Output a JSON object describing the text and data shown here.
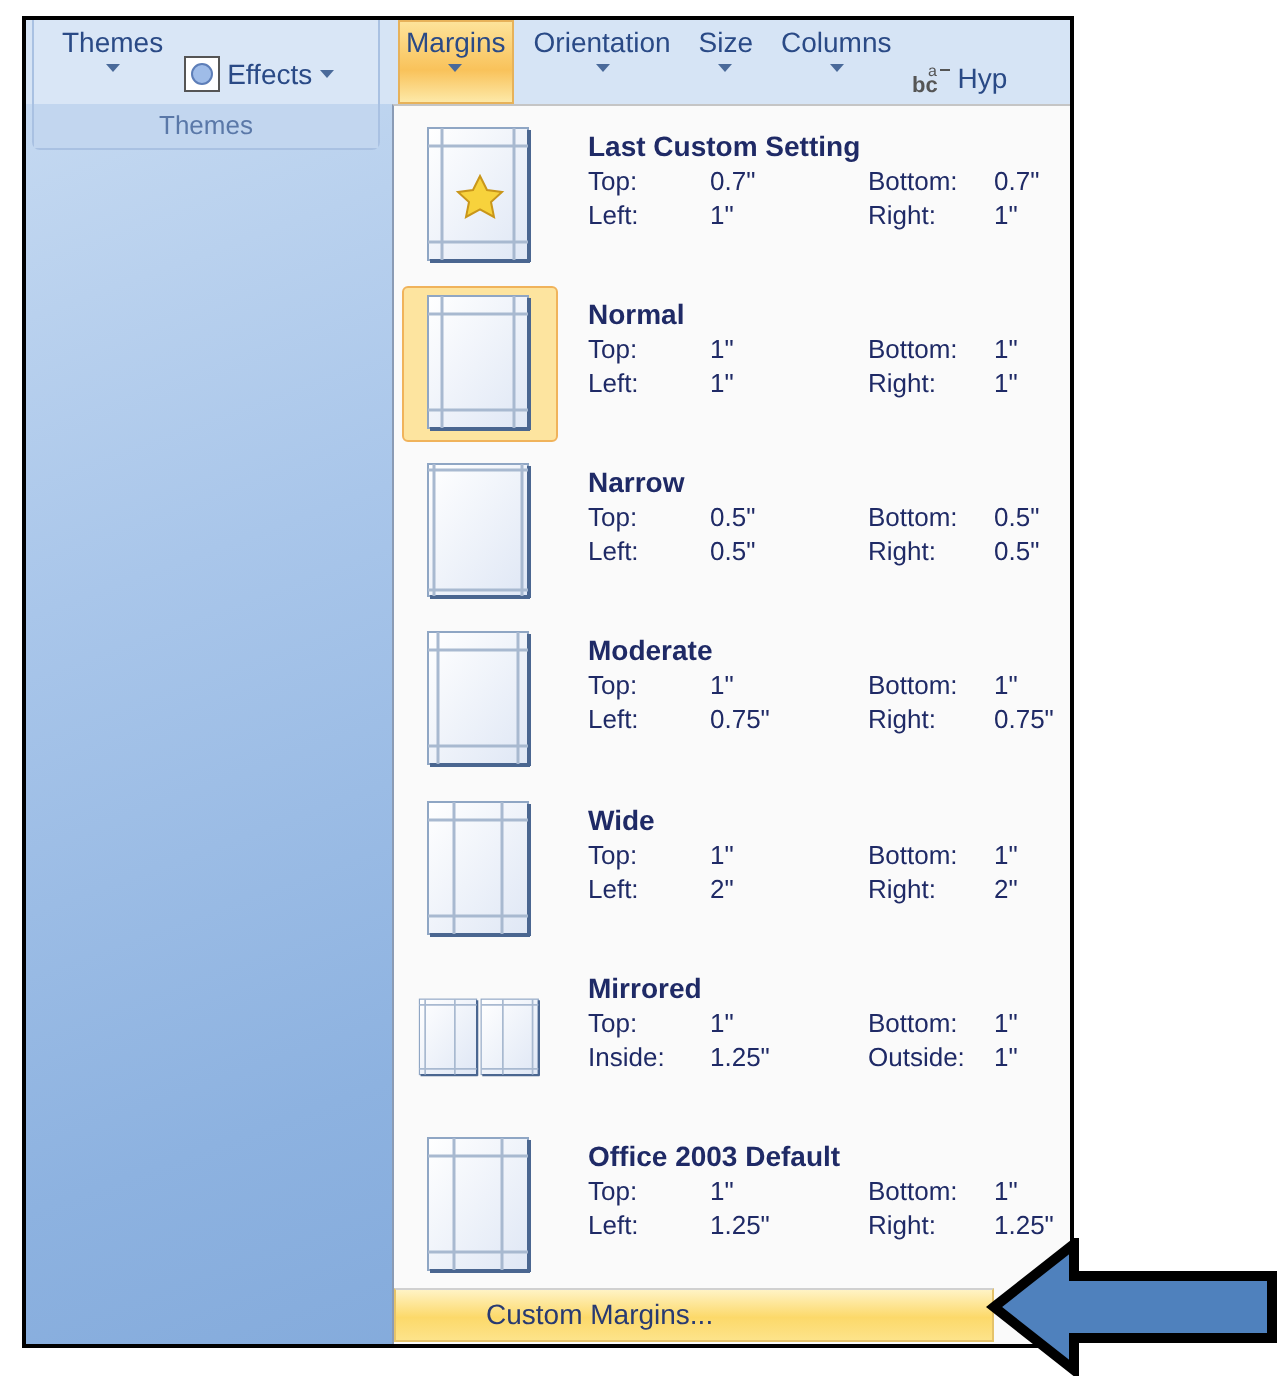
{
  "ribbon": {
    "themes_group": {
      "themes_button": "Themes",
      "effects_button": "Effects",
      "group_label": "Themes"
    },
    "buttons": [
      {
        "label": "Margins",
        "selected": true
      },
      {
        "label": "Orientation",
        "selected": false
      },
      {
        "label": "Size",
        "selected": false
      },
      {
        "label": "Columns",
        "selected": false
      }
    ],
    "hyphenation_icon": {
      "letters": "bc",
      "raised": "a"
    },
    "hyphenation_button": "Hyp"
  },
  "margins_menu": {
    "items": [
      {
        "title": "Last Custom Setting",
        "kind": "custom",
        "selected": false,
        "rows": [
          [
            "Top:",
            "0.7\"",
            "Bottom:",
            "0.7\""
          ],
          [
            "Left:",
            "1\"",
            "Right:",
            "1\""
          ]
        ]
      },
      {
        "title": "Normal",
        "kind": "normal",
        "selected": true,
        "rows": [
          [
            "Top:",
            "1\"",
            "Bottom:",
            "1\""
          ],
          [
            "Left:",
            "1\"",
            "Right:",
            "1\""
          ]
        ]
      },
      {
        "title": "Narrow",
        "kind": "narrow",
        "selected": false,
        "rows": [
          [
            "Top:",
            "0.5\"",
            "Bottom:",
            "0.5\""
          ],
          [
            "Left:",
            "0.5\"",
            "Right:",
            "0.5\""
          ]
        ]
      },
      {
        "title": "Moderate",
        "kind": "moderate",
        "selected": false,
        "rows": [
          [
            "Top:",
            "1\"",
            "Bottom:",
            "1\""
          ],
          [
            "Left:",
            "0.75\"",
            "Right:",
            "0.75\""
          ]
        ]
      },
      {
        "title": "Wide",
        "kind": "wide",
        "selected": false,
        "rows": [
          [
            "Top:",
            "1\"",
            "Bottom:",
            "1\""
          ],
          [
            "Left:",
            "2\"",
            "Right:",
            "2\""
          ]
        ]
      },
      {
        "title": "Mirrored",
        "kind": "mirrored",
        "selected": false,
        "rows": [
          [
            "Top:",
            "1\"",
            "Bottom:",
            "1\""
          ],
          [
            "Inside:",
            "1.25\"",
            "Outside:",
            "1\""
          ]
        ]
      },
      {
        "title": "Office 2003 Default",
        "kind": "wide",
        "selected": false,
        "rows": [
          [
            "Top:",
            "1\"",
            "Bottom:",
            "1\""
          ],
          [
            "Left:",
            "1.25\"",
            "Right:",
            "1.25\""
          ]
        ]
      }
    ],
    "footer": {
      "label": "Custom Margins...",
      "highlighted": true
    }
  }
}
